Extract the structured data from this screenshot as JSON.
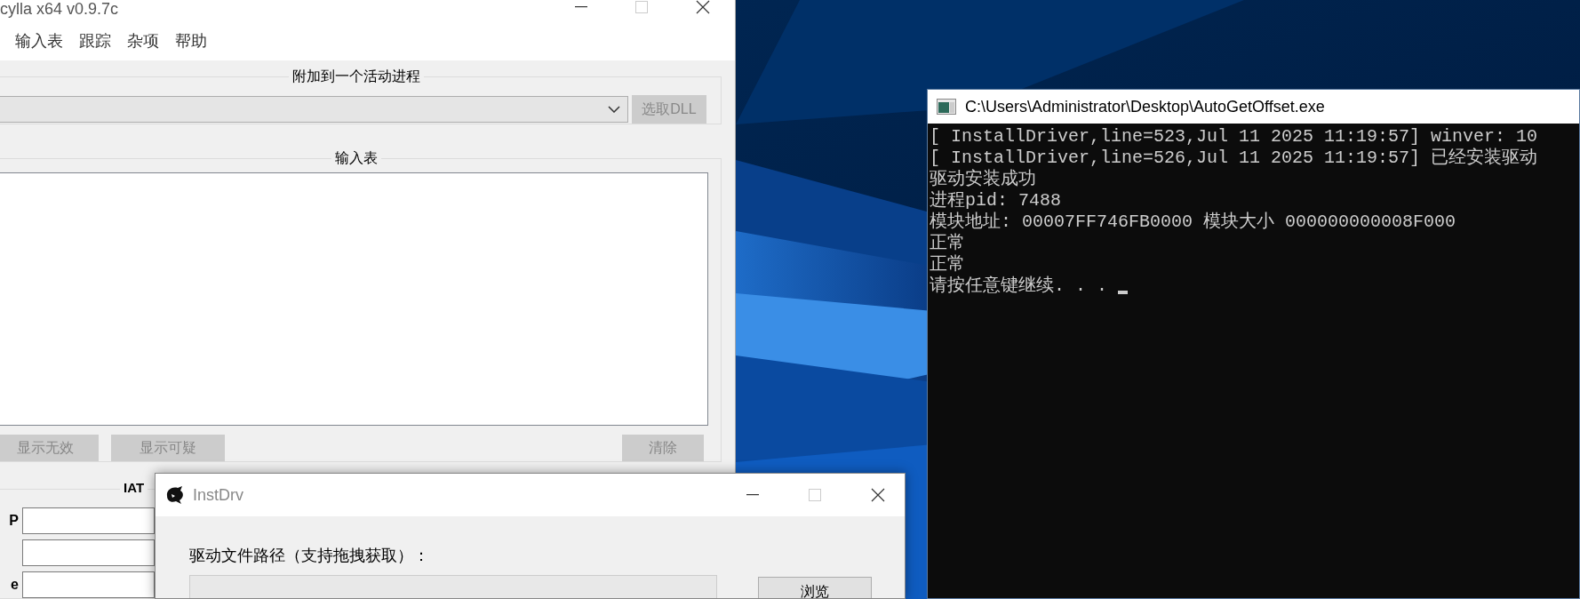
{
  "scylla": {
    "title": "cylla x64 v0.9.7c",
    "menu": [
      "输入表",
      "跟踪",
      "杂项",
      "帮助"
    ],
    "attach_group": {
      "title": "附加到一个活动进程",
      "pick_dll_button": {
        "label": "选取DLL",
        "disabled": true
      }
    },
    "imports_group": {
      "title": "输入表",
      "buttons": [
        {
          "label": "显示无效",
          "disabled": true
        },
        {
          "label": "显示可疑",
          "disabled": true
        },
        {
          "label": "清除",
          "disabled": true
        }
      ]
    },
    "iat_group": {
      "title": "IAT",
      "fields": [
        {
          "kind": "labeled",
          "label": "P"
        },
        {
          "kind": "plain"
        },
        {
          "kind": "labeled",
          "label": "e"
        }
      ]
    }
  },
  "console": {
    "title": "C:\\Users\\Administrator\\Desktop\\AutoGetOffset.exe",
    "lines": [
      "[ InstallDriver,line=523,Jul 11 2025 11:19:57] winver: 10",
      "[ InstallDriver,line=526,Jul 11 2025 11:19:57] 已经安装驱动",
      "驱动安装成功",
      "进程pid: 7488",
      "模块地址: 00007FF746FB0000 模块大小 000000000008F000",
      "正常",
      "正常",
      "请按任意键继续. . ."
    ],
    "cursor": true
  },
  "instdrv": {
    "title": "InstDrv",
    "path_label": "驱动文件路径（支持拖拽获取）：",
    "browse_button": "浏览"
  }
}
